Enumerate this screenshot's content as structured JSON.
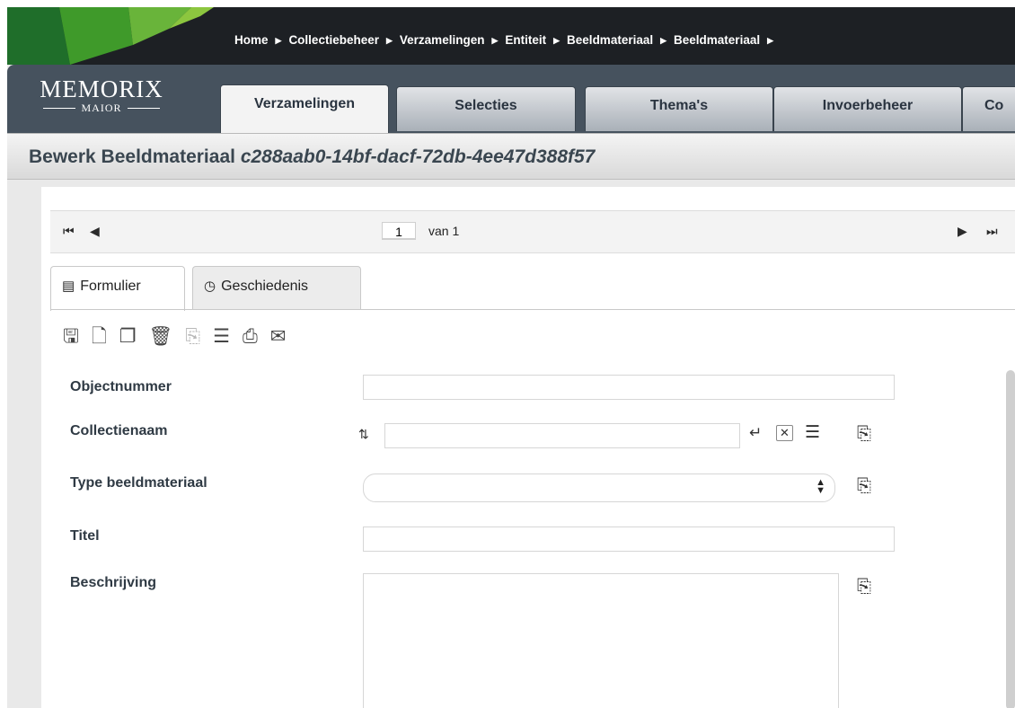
{
  "breadcrumb": [
    "Home",
    "Collectiebeheer",
    "Verzamelingen",
    "Entiteit",
    "Beeldmateriaal",
    "Beeldmateriaal"
  ],
  "brand": {
    "line1": "MEMORIX",
    "line2": "MAIOR"
  },
  "nav_tabs": [
    {
      "label": "Verzamelingen",
      "active": true
    },
    {
      "label": "Selecties",
      "active": false
    },
    {
      "label": "Thema's",
      "active": false
    },
    {
      "label": "Invoerbeheer",
      "active": false
    },
    {
      "label": "Co",
      "active": false
    }
  ],
  "title": {
    "prefix": "Bewerk Beeldmateriaal",
    "id": "c288aab0-14bf-dacf-72db-4ee47d388f57"
  },
  "pager": {
    "current": "1",
    "of_label": "van 1",
    "first_icon": "first-page-icon",
    "prev_icon": "prev-page-icon",
    "next_icon": "next-page-icon",
    "last_icon": "last-page-icon"
  },
  "form_tabs": [
    {
      "label": "Formulier",
      "icon": "form-icon",
      "active": true
    },
    {
      "label": "Geschiedenis",
      "icon": "history-icon",
      "active": false
    }
  ],
  "toolbar_icons": [
    "save-icon",
    "new-record-icon",
    "copy-icon",
    "delete-icon",
    "import-icon",
    "notes-icon",
    "print-icon",
    "email-icon"
  ],
  "fields": {
    "objectnummer": {
      "label": "Objectnummer",
      "value": ""
    },
    "collectienaam": {
      "label": "Collectienaam",
      "value": ""
    },
    "type": {
      "label": "Type beeldmateriaal",
      "value": ""
    },
    "titel": {
      "label": "Titel",
      "value": ""
    },
    "beschrijving": {
      "label": "Beschrijving",
      "value": ""
    }
  },
  "colors": {
    "topbar": "#1d2024",
    "tabstrip": "#46525e",
    "title_text": "#3a4650",
    "accent_green": "#3f9a2a"
  }
}
